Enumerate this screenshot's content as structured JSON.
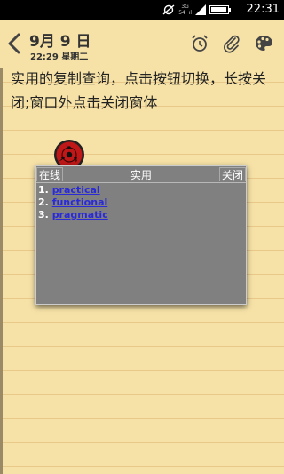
{
  "status_bar": {
    "network_top": "3G",
    "network_bottom": "54··ıl",
    "battery_level": 0.95,
    "time": "22:31"
  },
  "header": {
    "date": "9月 9 日",
    "subtitle": "22:29 星期二",
    "icons": [
      "back-icon",
      "alarm-icon",
      "paperclip-icon",
      "palette-icon"
    ]
  },
  "note": {
    "text": "实用的复制查询，点击按钮切换，长按关闭;窗口外点击关闭窗体"
  },
  "popup": {
    "left_button": "在线",
    "title": "实用",
    "right_button": "关闭",
    "results": [
      {
        "num": "1.",
        "word": "practical"
      },
      {
        "num": "2.",
        "word": "functional"
      },
      {
        "num": "3.",
        "word": "pragmatic"
      }
    ]
  },
  "colors": {
    "paper": "#f6e2a7",
    "rule_line": "#e8c98a",
    "popup_bg": "#808080",
    "link": "#2a2ad8"
  }
}
